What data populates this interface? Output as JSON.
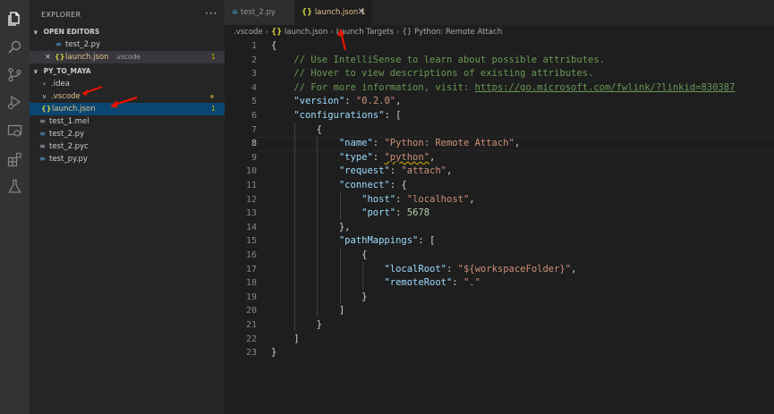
{
  "activity_bar": {
    "icons": [
      "files-icon",
      "search-icon",
      "source-control-icon",
      "run-debug-icon",
      "remote-explorer-icon",
      "extensions-icon",
      "testing-icon"
    ]
  },
  "sidebar": {
    "title": "EXPLORER",
    "more": "···",
    "open_editors": {
      "header": "OPEN EDITORS",
      "items": [
        {
          "name": "test_2.py"
        },
        {
          "close": "✕",
          "name": "launch.json",
          "path": ".vscode",
          "problems": "1"
        }
      ]
    },
    "workspace": {
      "header": "PY_TO_MAYA",
      "items": [
        {
          "chev": "›",
          "name": ".idea"
        },
        {
          "chev": "∨",
          "name": ".vscode"
        },
        {
          "name": "launch.json",
          "problems": "1"
        },
        {
          "name": "test_1.mel"
        },
        {
          "name": "test_2.py"
        },
        {
          "name": "test_2.pyc"
        },
        {
          "name": "test_py.py"
        }
      ]
    }
  },
  "tabs": [
    {
      "label": "test_2.py"
    },
    {
      "label": "launch.json 1",
      "close": "✕"
    }
  ],
  "breadcrumb": [
    ".vscode",
    "launch.json",
    "Launch Targets",
    "Python: Remote Attach"
  ],
  "editor": {
    "line_numbers": [
      "1",
      "2",
      "3",
      "4",
      "5",
      "6",
      "7",
      "8",
      "9",
      "10",
      "11",
      "12",
      "13",
      "14",
      "15",
      "16",
      "17",
      "18",
      "19",
      "20",
      "21",
      "22",
      "23"
    ],
    "current_line": "8",
    "code": {
      "l1": "{",
      "l2": "// Use IntelliSense to learn about possible attributes.",
      "l3": "// Hover to view descriptions of existing attributes.",
      "l4a": "// For more information, visit: ",
      "l4b": "https://go.microsoft.com/fwlink/?linkid=830387",
      "l5k": "\"version\"",
      "l5v": "\"0.2.0\"",
      "l6k": "\"configurations\"",
      "l6v": "[",
      "l7": "{",
      "l8k": "\"name\"",
      "l8v": "\"Python: Remote Attach\"",
      "l9k": "\"type\"",
      "l9v": "\"python\"",
      "l10k": "\"request\"",
      "l10v": "\"attach\"",
      "l11k": "\"connect\"",
      "l11v": "{",
      "l12k": "\"host\"",
      "l12v": "\"localhost\"",
      "l13k": "\"port\"",
      "l13v": "5678",
      "l14": "},",
      "l15k": "\"pathMappings\"",
      "l15v": "[",
      "l16": "{",
      "l17k": "\"localRoot\"",
      "l17v": "\"${workspaceFolder}\"",
      "l18k": "\"remoteRoot\"",
      "l18v": "\".\"",
      "l19": "}",
      "l20": "]",
      "l21": "}",
      "l22": "]",
      "l23": "}"
    }
  },
  "colors": {
    "comment": "#6a9955",
    "key": "#9cdcfe",
    "string": "#ce9178",
    "number": "#b5cea8",
    "annotation": "#e51400"
  }
}
